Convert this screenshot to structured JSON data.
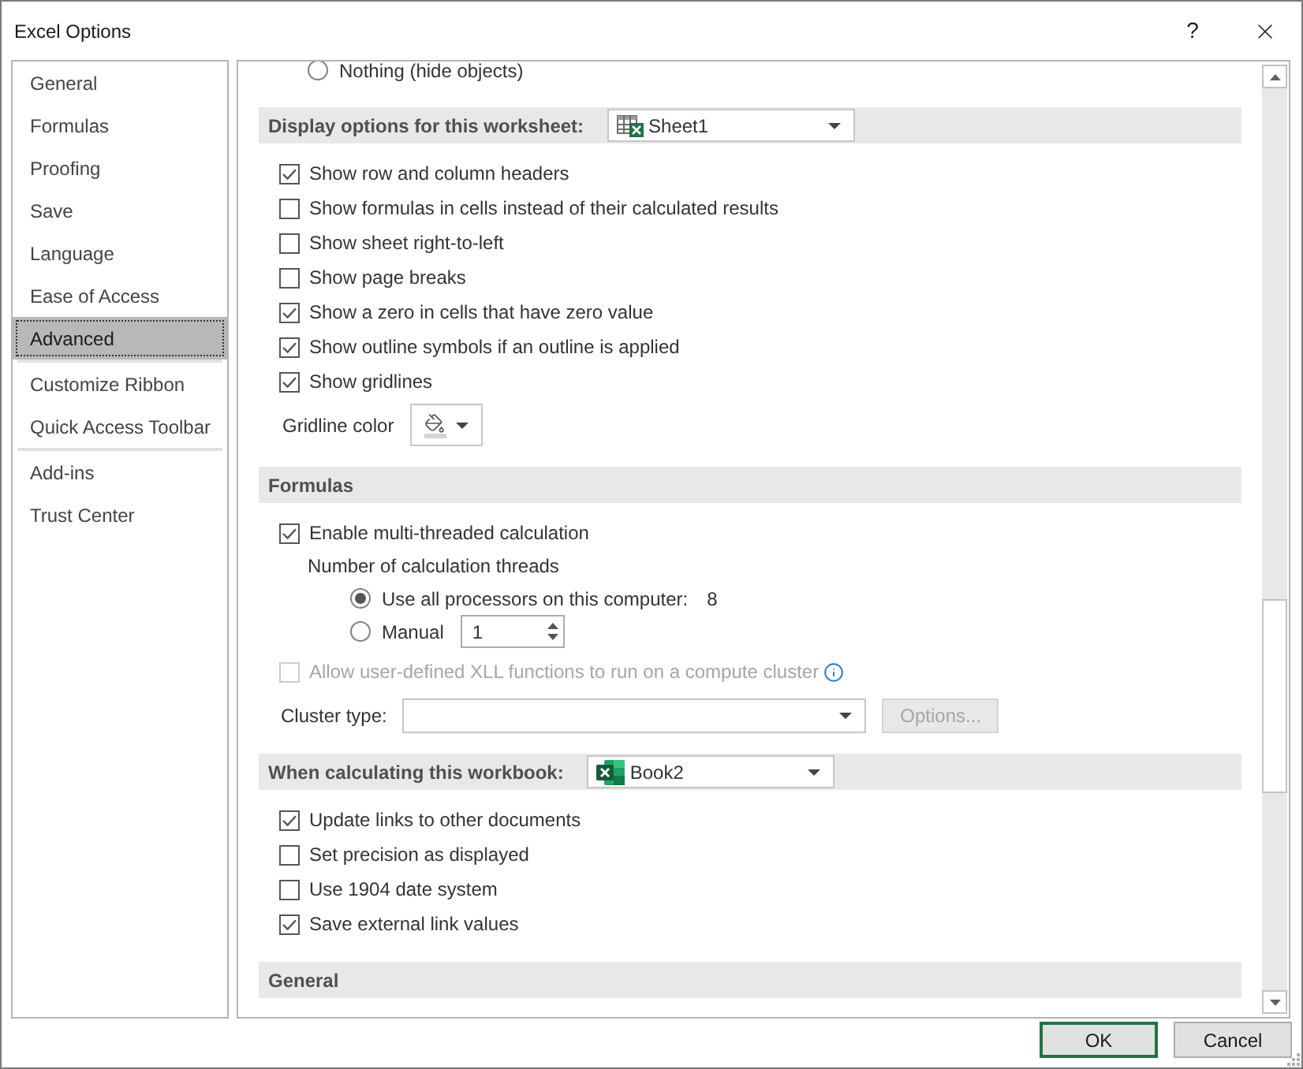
{
  "window": {
    "title": "Excel Options",
    "help": "?"
  },
  "sidebar": {
    "groups": [
      {
        "items": [
          {
            "label": "General",
            "selected": false
          },
          {
            "label": "Formulas",
            "selected": false
          },
          {
            "label": "Proofing",
            "selected": false
          },
          {
            "label": "Save",
            "selected": false
          },
          {
            "label": "Language",
            "selected": false
          },
          {
            "label": "Ease of Access",
            "selected": false
          },
          {
            "label": "Advanced",
            "selected": true
          }
        ]
      },
      {
        "items": [
          {
            "label": "Customize Ribbon",
            "selected": false
          },
          {
            "label": "Quick Access Toolbar",
            "selected": false
          }
        ]
      },
      {
        "items": [
          {
            "label": "Add-ins",
            "selected": false
          },
          {
            "label": "Trust Center",
            "selected": false
          }
        ]
      }
    ]
  },
  "content": {
    "leading_option": {
      "kind": "radio",
      "label": "Nothing (hide objects)",
      "selected": false
    },
    "sections": [
      {
        "title": "Display options for this worksheet:",
        "dropdown": {
          "kind": "worksheet",
          "value": "Sheet1"
        },
        "options": [
          {
            "kind": "checkbox",
            "label": "Show row and column headers",
            "checked": true
          },
          {
            "kind": "checkbox",
            "label": "Show formulas in cells instead of their calculated results",
            "checked": false
          },
          {
            "kind": "checkbox",
            "label": "Show sheet right-to-left",
            "checked": false
          },
          {
            "kind": "checkbox",
            "label": "Show page breaks",
            "checked": false
          },
          {
            "kind": "checkbox",
            "label": "Show a zero in cells that have zero value",
            "checked": true
          },
          {
            "kind": "checkbox",
            "label": "Show outline symbols if an outline is applied",
            "checked": true
          },
          {
            "kind": "checkbox",
            "label": "Show gridlines",
            "checked": true
          },
          {
            "kind": "color",
            "label": "Gridline color"
          }
        ]
      },
      {
        "title": "Formulas",
        "options": [
          {
            "kind": "checkbox",
            "label": "Enable multi-threaded calculation",
            "checked": true,
            "disabled": false,
            "children": [
              {
                "kind": "caption",
                "label": "Number of calculation threads",
                "children": [
                  {
                    "kind": "radio",
                    "label": "Use all processors on this computer:",
                    "selected": true,
                    "value": "8"
                  },
                  {
                    "kind": "radio",
                    "label": "Manual",
                    "selected": false,
                    "spin_value": "1"
                  }
                ]
              }
            ]
          },
          {
            "kind": "checkbox",
            "label": "Allow user-defined XLL functions to run on a compute cluster",
            "checked": false,
            "disabled": true,
            "info": true
          },
          {
            "kind": "select",
            "label": "Cluster type:",
            "disabled": false,
            "button": {
              "label": "Options...",
              "disabled": true
            }
          }
        ]
      },
      {
        "title": "When calculating this workbook:",
        "dropdown": {
          "kind": "workbook",
          "value": "Book2"
        },
        "options": [
          {
            "kind": "checkbox",
            "label": "Update links to other documents",
            "checked": true
          },
          {
            "kind": "checkbox",
            "label": "Set precision as displayed",
            "checked": false
          },
          {
            "kind": "checkbox",
            "label": "Use 1904 date system",
            "checked": false
          },
          {
            "kind": "checkbox",
            "label": "Save external link values",
            "checked": true
          }
        ]
      },
      {
        "title": "General"
      }
    ]
  },
  "buttons": [
    {
      "label": "OK",
      "default": true
    },
    {
      "label": "Cancel",
      "default": false
    }
  ]
}
